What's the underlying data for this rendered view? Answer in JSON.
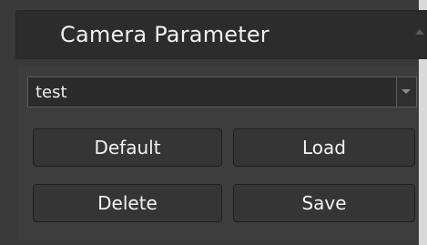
{
  "panel": {
    "title": "Camera Parameter",
    "collapse_icon": "triangle-up-icon"
  },
  "profile_select": {
    "selected": "test",
    "dropdown_icon": "chevron-down-icon"
  },
  "buttons": {
    "default_label": "Default",
    "load_label": "Load",
    "delete_label": "Delete",
    "save_label": "Save"
  },
  "colors": {
    "panel_bg": "#3a3a3a",
    "header_bg": "#2c2c2c",
    "button_bg": "#353535",
    "text": "#f0f0f0"
  }
}
